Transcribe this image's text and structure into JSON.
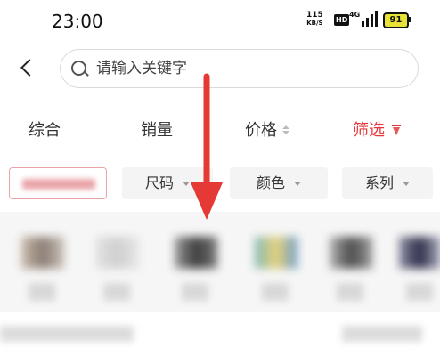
{
  "status_bar": {
    "time": "23:00",
    "net_speed_value": "115",
    "net_speed_unit": "KB/S",
    "hd_badge": "HD",
    "network": "4G",
    "battery": "91"
  },
  "search": {
    "placeholder": "请输入关键字",
    "value": ""
  },
  "sort_tabs": {
    "overall": "综合",
    "sales": "销量",
    "price": "价格",
    "filter": "筛选"
  },
  "filter_chips": {
    "size": "尺码",
    "color": "颜色",
    "series": "系列"
  },
  "colors": {
    "accent": "#e4393c",
    "annotation_arrow": "#e53935",
    "chip_background": "#f4f4f4"
  },
  "icons": [
    "back-icon",
    "search-icon",
    "sort-icon",
    "funnel-icon",
    "caret-down-icon",
    "down-arrow-annotation"
  ]
}
